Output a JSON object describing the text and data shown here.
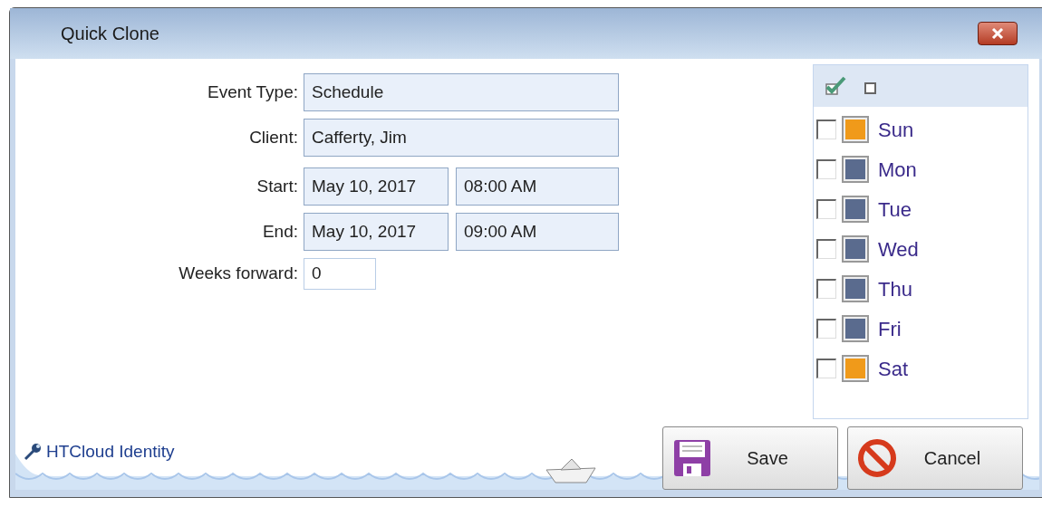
{
  "window": {
    "title": "Quick Clone"
  },
  "form": {
    "event_type": {
      "label": "Event Type:",
      "value": "Schedule"
    },
    "client": {
      "label": "Client:",
      "value": "Cafferty, Jim"
    },
    "start": {
      "label": "Start:",
      "date": "May 10, 2017",
      "time": "08:00 AM"
    },
    "end": {
      "label": "End:",
      "date": "May 10, 2017",
      "time": "09:00 AM"
    },
    "weeks_forward": {
      "label": "Weeks forward:",
      "value": "0"
    }
  },
  "days": [
    {
      "label": "Sun",
      "checked": false,
      "color": "#f09a1a"
    },
    {
      "label": "Mon",
      "checked": false,
      "color": "#5a6b8e"
    },
    {
      "label": "Tue",
      "checked": false,
      "color": "#5a6b8e"
    },
    {
      "label": "Wed",
      "checked": false,
      "color": "#5a6b8e"
    },
    {
      "label": "Thu",
      "checked": false,
      "color": "#5a6b8e"
    },
    {
      "label": "Fri",
      "checked": false,
      "color": "#5a6b8e"
    },
    {
      "label": "Sat",
      "checked": false,
      "color": "#f09a1a"
    }
  ],
  "footer": {
    "link": "HTCloud Identity"
  },
  "buttons": [
    {
      "kind": "save",
      "label": "Save"
    },
    {
      "kind": "cancel",
      "label": "Cancel"
    }
  ]
}
